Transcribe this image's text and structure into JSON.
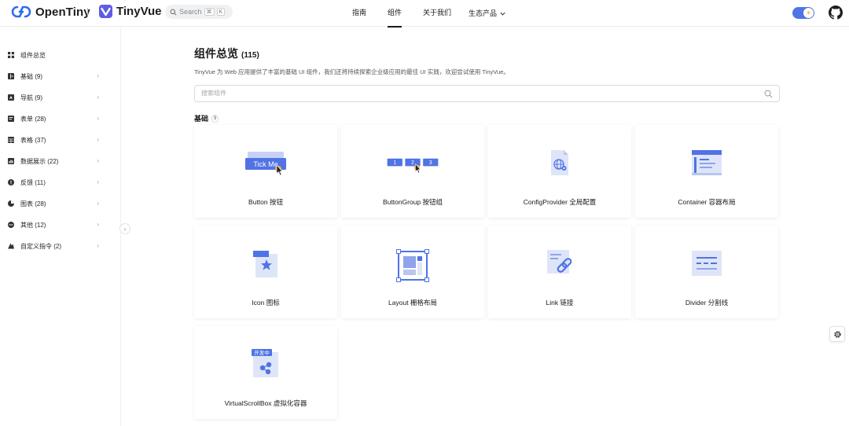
{
  "header": {
    "brand1": "OpenTiny",
    "brand2": "TinyVue",
    "search": {
      "placeholder": "Search",
      "key1": "⌘",
      "key2": "K"
    },
    "nav": [
      "指南",
      "组件",
      "关于我们",
      "生态产品"
    ],
    "active_nav": "组件",
    "accent": "#5073e5"
  },
  "sidebar": {
    "items": [
      {
        "label": "组件总览",
        "icon": "grid-icon",
        "chevron": false
      },
      {
        "label": "基础 (9)",
        "icon": "layout-icon",
        "chevron": true
      },
      {
        "label": "导航 (9)",
        "icon": "navigation-icon",
        "chevron": true
      },
      {
        "label": "表单 (28)",
        "icon": "form-icon",
        "chevron": true
      },
      {
        "label": "表格 (37)",
        "icon": "table-icon",
        "chevron": true
      },
      {
        "label": "数据展示 (22)",
        "icon": "data-display-icon",
        "chevron": true
      },
      {
        "label": "反馈 (11)",
        "icon": "feedback-icon",
        "chevron": true
      },
      {
        "label": "图表 (28)",
        "icon": "chart-icon",
        "chevron": true
      },
      {
        "label": "其他 (12)",
        "icon": "more-icon",
        "chevron": true
      },
      {
        "label": "自定义指令 (2)",
        "icon": "directive-icon",
        "chevron": true
      }
    ]
  },
  "main": {
    "title": "组件总览",
    "count": "(115)",
    "description": "TinyVue 为 Web 应用提供了丰富的基础 UI 组件，我们还将持续探索企业级应用的最佳 UI 实践，欢迎尝试使用 TinyVue。",
    "filter_placeholder": "搜索组件",
    "group": {
      "title": "基础",
      "count": "9"
    },
    "cards": [
      {
        "label": "Button 按钮",
        "icon": "button-illustration",
        "img_text": "Tick Me"
      },
      {
        "label": "ButtonGroup 按钮组",
        "icon": "button-group-illustration",
        "img_text": [
          "1",
          "2",
          "3"
        ]
      },
      {
        "label": "ConfigProvider 全局配置",
        "icon": "config-provider-illustration"
      },
      {
        "label": "Container 容器布局",
        "icon": "container-illustration"
      },
      {
        "label": "Icon 图标",
        "icon": "icon-illustration"
      },
      {
        "label": "Layout 栅格布局",
        "icon": "layout-illustration"
      },
      {
        "label": "Link 链接",
        "icon": "link-illustration"
      },
      {
        "label": "Divider 分割线",
        "icon": "divider-illustration"
      },
      {
        "label": "VirtualScrollBox 虚拟化容器",
        "icon": "virtual-scroll-illustration",
        "img_text": "开发中"
      }
    ]
  }
}
